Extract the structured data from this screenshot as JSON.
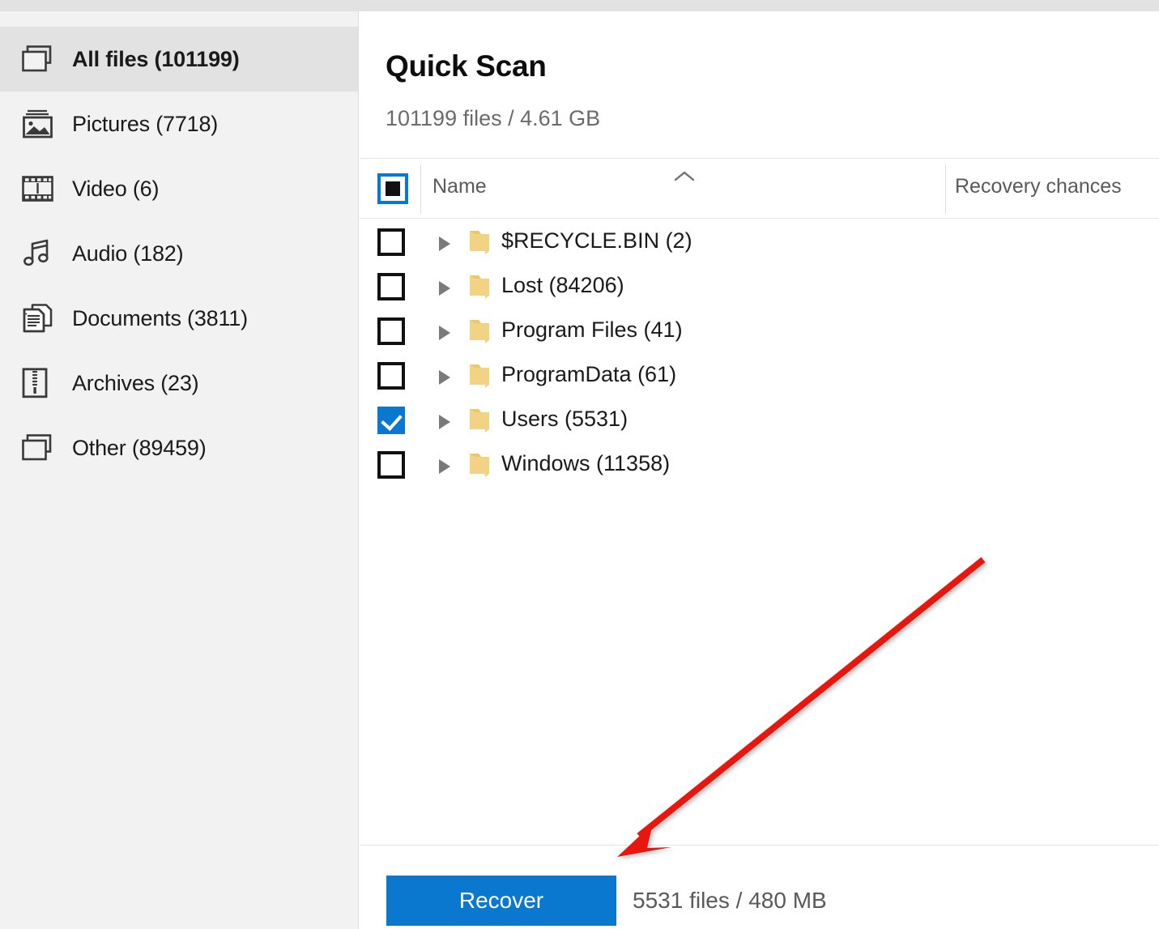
{
  "sidebar": {
    "items": [
      {
        "label": "All files (101199)",
        "icon": "stacked-windows-icon",
        "active": true
      },
      {
        "label": "Pictures (7718)",
        "icon": "picture-icon",
        "active": false
      },
      {
        "label": "Video (6)",
        "icon": "film-strip-icon",
        "active": false
      },
      {
        "label": "Audio (182)",
        "icon": "music-note-icon",
        "active": false
      },
      {
        "label": "Documents (3811)",
        "icon": "documents-icon",
        "active": false
      },
      {
        "label": "Archives (23)",
        "icon": "archive-zip-icon",
        "active": false
      },
      {
        "label": "Other (89459)",
        "icon": "stacked-windows-icon",
        "active": false
      }
    ]
  },
  "main": {
    "title": "Quick Scan",
    "subtitle": "101199 files / 4.61 GB",
    "table": {
      "headers": {
        "name": "Name",
        "recovery_chances": "Recovery chances",
        "sort_indicator": "chevron-up-icon",
        "select_all_state": "indeterminate"
      },
      "rows": [
        {
          "name": "$RECYCLE.BIN (2)",
          "checked": false,
          "expanded": false,
          "recovery_chances": ""
        },
        {
          "name": "Lost (84206)",
          "checked": false,
          "expanded": false,
          "recovery_chances": ""
        },
        {
          "name": "Program Files (41)",
          "checked": false,
          "expanded": false,
          "recovery_chances": ""
        },
        {
          "name": "ProgramData (61)",
          "checked": false,
          "expanded": false,
          "recovery_chances": ""
        },
        {
          "name": "Users (5531)",
          "checked": true,
          "expanded": false,
          "recovery_chances": ""
        },
        {
          "name": "Windows (11358)",
          "checked": false,
          "expanded": false,
          "recovery_chances": ""
        }
      ]
    }
  },
  "footer": {
    "recover_label": "Recover",
    "selection_info": "5531 files / 480 MB"
  },
  "colors": {
    "accent": "#0b78d0",
    "sidebar_bg": "#f2f2f2",
    "sidebar_active_bg": "#e2e2e2",
    "annotation_arrow": "#e8140f",
    "folder": "#f2d384"
  }
}
